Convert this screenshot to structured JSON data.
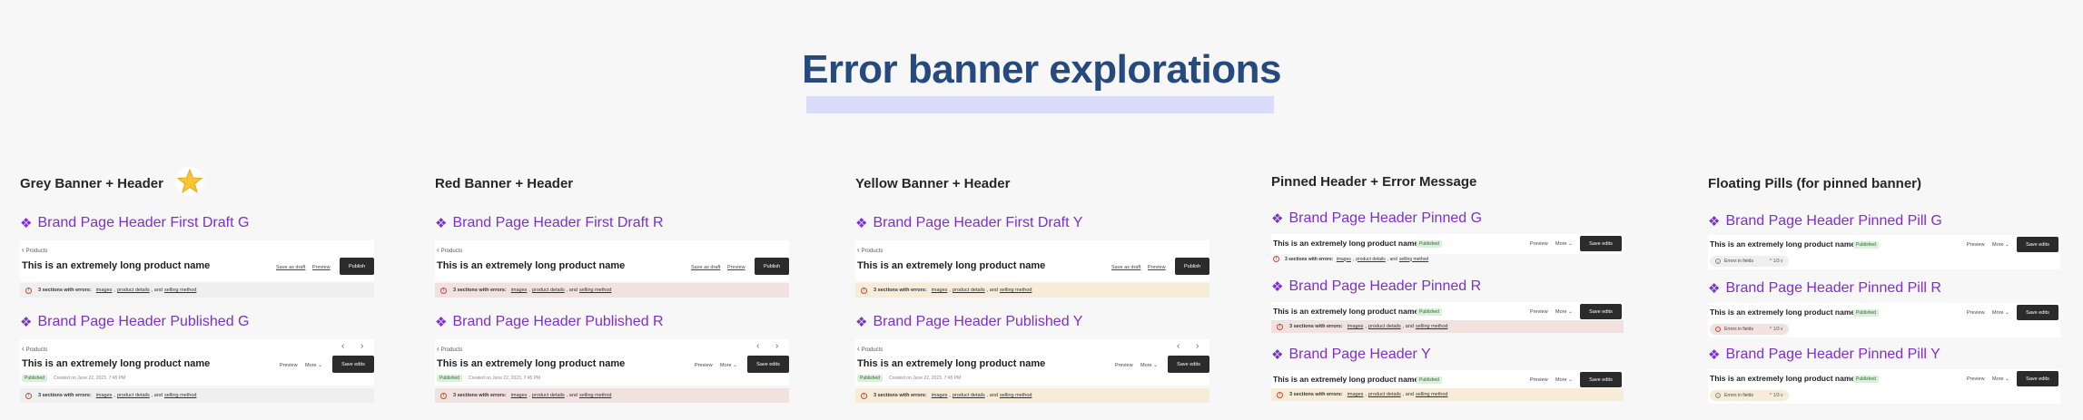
{
  "page": {
    "title": "Error banner explorations"
  },
  "common": {
    "breadcrumb": "Products",
    "product_name": "This is an extremely long product name",
    "save_as_draft": "Save as draft",
    "preview": "Preview",
    "publish": "Publish",
    "more": "More",
    "save_edits": "Save edits",
    "published_badge": "Published",
    "created": "Created on June 22, 2023, 7:45 PM",
    "error_prefix": "3 sections with errors:",
    "err_images": "images",
    "err_details": "product details",
    "err_and": ", and",
    "err_selling": "selling method",
    "errors_in_fields": "Errors in fields",
    "pill_nav": "^ 1/3 v"
  },
  "columns": {
    "grey": {
      "title": "Grey Banner + Header",
      "draft_title": "Brand Page Header First Draft G",
      "published_title": "Brand Page Header Published G"
    },
    "red": {
      "title": "Red Banner + Header",
      "draft_title": "Brand Page Header First Draft R",
      "published_title": "Brand Page Header Published R"
    },
    "yellow": {
      "title": "Yellow Banner + Header",
      "draft_title": "Brand Page Header First Draft Y",
      "published_title": "Brand Page Header Published Y"
    },
    "pinned": {
      "title": "Pinned Header +  Error Message",
      "g_title": "Brand Page Header Pinned G",
      "r_title": "Brand Page Header Pinned R",
      "y_title": "Brand Page Header Y"
    },
    "pills": {
      "title": "Floating Pills (for pinned banner)",
      "g_title": "Brand Page Header Pinned Pill G",
      "r_title": "Brand Page Header Pinned Pill R",
      "y_title": "Brand Page Header Pinned Pill Y"
    }
  },
  "icons": {
    "diamond": "diamond-icon",
    "star": "star-icon",
    "error": "error-circle-icon"
  },
  "colors": {
    "title": "#26497e",
    "component": "#7d2fd0",
    "red_banner": "#f1e2df",
    "yellow_banner": "#f7ecd8",
    "grey_banner": "#efefef"
  }
}
